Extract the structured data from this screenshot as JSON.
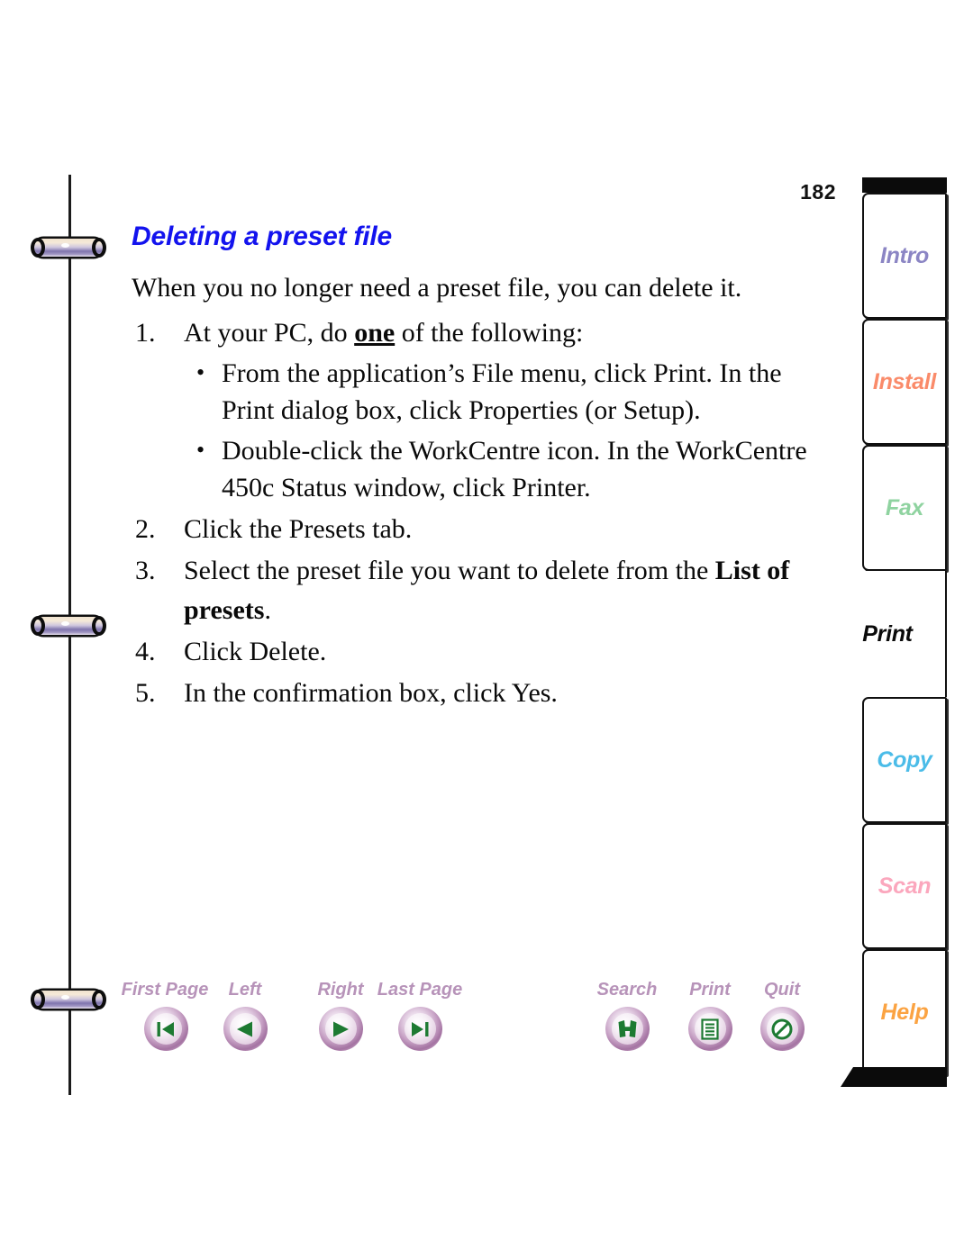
{
  "document": {
    "page_number": "182",
    "section_title": "Deleting a preset file",
    "title_color": "#1313ee"
  },
  "body": {
    "intro": "When you no longer need a preset file, you can delete it.",
    "steps": [
      {
        "num": "1.",
        "text_before": "At your PC, do ",
        "emphasis": "one",
        "text_after": " of the following:",
        "sub_bullets": [
          {
            "bullet": "•",
            "text": "From the application’s File menu, click Print. In the Print dialog box, click Properties (or Setup)."
          },
          {
            "bullet": "•",
            "text": "Double-click the WorkCentre icon. In the WorkCentre 450c Status window, click Printer."
          }
        ]
      },
      {
        "num": "2.",
        "text": "Click the Presets tab."
      },
      {
        "num": "3.",
        "text_before": "Select the preset file you want to delete from the ",
        "emphasis_bold": "List of presets",
        "text_after": "."
      },
      {
        "num": "4.",
        "text": "Click Delete."
      },
      {
        "num": "5.",
        "text": "In the confirmation box, click Yes."
      }
    ]
  },
  "tabs": [
    {
      "id": "intro",
      "label": "Intro",
      "color": "#8b85c4",
      "active": false
    },
    {
      "id": "install",
      "label": "Install",
      "color": "#fa8b6a",
      "active": false
    },
    {
      "id": "fax",
      "label": "Fax",
      "color": "#8fd3a0",
      "active": false
    },
    {
      "id": "print",
      "label": "Print",
      "color": "#0a0a0a",
      "active": true
    },
    {
      "id": "copy",
      "label": "Copy",
      "color": "#4bbce8",
      "active": false
    },
    {
      "id": "scan",
      "label": "Scan",
      "color": "#fba7bd",
      "active": false
    },
    {
      "id": "help",
      "label": "Help",
      "color": "#fba342",
      "active": false
    }
  ],
  "navbar": {
    "label_color": "#b793b9",
    "glyph_color": "#1d7a32",
    "left_group": [
      {
        "id": "first-page",
        "label": "First Page",
        "icon": "first-page-icon"
      },
      {
        "id": "left",
        "label": "Left",
        "icon": "previous-page-icon"
      },
      {
        "id": "right",
        "label": "Right",
        "icon": "next-page-icon"
      },
      {
        "id": "last-page",
        "label": "Last Page",
        "icon": "last-page-icon"
      }
    ],
    "right_group": [
      {
        "id": "search",
        "label": "Search",
        "icon": "binoculars-icon"
      },
      {
        "id": "print",
        "label": "Print",
        "icon": "document-print-icon"
      },
      {
        "id": "quit",
        "label": "Quit",
        "icon": "no-entry-icon"
      }
    ]
  },
  "binding": {
    "ring_count": 3
  }
}
